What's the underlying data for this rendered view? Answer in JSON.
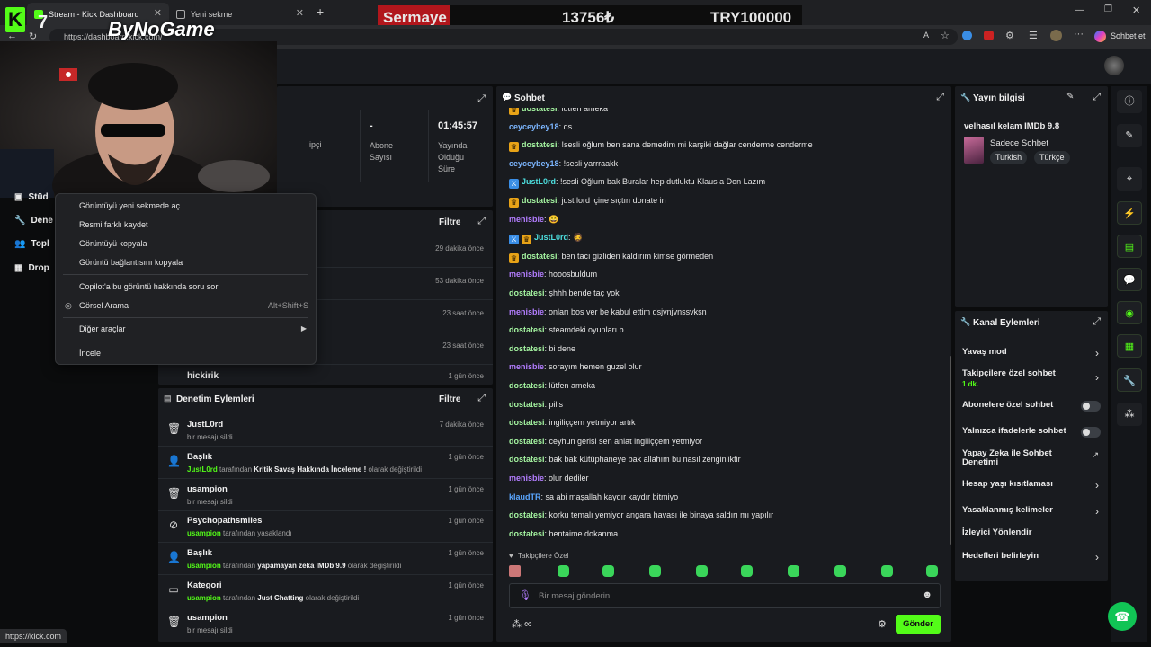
{
  "browser": {
    "tabs": [
      {
        "title": "Stream - Kick Dashboard",
        "active": true
      },
      {
        "title": "Yeni sekme",
        "active": false
      }
    ],
    "new_tab_icon": "plus-icon",
    "url": "https://dashboard.kick.com/",
    "chat_button": "Sohbet et"
  },
  "overlay": {
    "logo_mark": "K",
    "logo_number": "7",
    "brand": "ByNoGame",
    "ticker_label": "Sermaye",
    "ticker_value": "13756₺",
    "ticker_goal": "TRY100000"
  },
  "colors": {
    "accent": "#53fc18",
    "panel": "#191b1f",
    "bg": "#0b0c0d"
  },
  "left_nav": {
    "items": [
      {
        "label": "Stüd",
        "icon": "studio-icon"
      },
      {
        "label": "Dene",
        "icon": "wrench-icon"
      },
      {
        "label": "Topl",
        "icon": "users-icon"
      },
      {
        "label": "Drop",
        "icon": "drops-icon"
      }
    ]
  },
  "stats": {
    "fragment": "ipçi",
    "subscribers_value": "-",
    "subscribers_label": "Abone Sayısı",
    "uptime_value": "01:45:57",
    "uptime_label": "Yayında Olduğu Süre"
  },
  "followers_panel": {
    "filter": "Filtre",
    "times": [
      "29 dakika önce",
      "53 dakika önce",
      "23 saat önce",
      "23 saat önce"
    ],
    "last_name": "hickirik",
    "last_time": "1 gün önce"
  },
  "mod_actions": {
    "title": "Denetim Eylemleri",
    "filter": "Filtre",
    "items": [
      {
        "icon": "trash-icon",
        "title": "JustL0rd",
        "time": "7 dakika önce",
        "user": "",
        "middle": "bir mesajı sildi",
        "value": "",
        "tail": ""
      },
      {
        "icon": "user-edit-icon",
        "title": "Başlık",
        "time": "1 gün önce",
        "user": "JustL0rd",
        "middle": "tarafından",
        "value": "Kritik Savaş Hakkında İnceleme !",
        "tail": "olarak değiştirildi"
      },
      {
        "icon": "trash-icon",
        "title": "usampion",
        "time": "1 gün önce",
        "user": "",
        "middle": "bir mesajı sildi",
        "value": "",
        "tail": ""
      },
      {
        "icon": "ban-icon",
        "title": "Psychopathsmiles",
        "time": "1 gün önce",
        "user": "usampion",
        "middle": "tarafından yasaklandı",
        "value": "",
        "tail": ""
      },
      {
        "icon": "user-edit-icon",
        "title": "Başlık",
        "time": "1 gün önce",
        "user": "usampion",
        "middle": "tarafından",
        "value": "yapamayan zeka IMDb 9.9",
        "tail": "olarak değiştirildi"
      },
      {
        "icon": "category-icon",
        "title": "Kategori",
        "time": "1 gün önce",
        "user": "usampion",
        "middle": "tarafından",
        "value": "Just Chatting",
        "tail": "olarak değiştirildi"
      },
      {
        "icon": "trash-icon",
        "title": "usampion",
        "time": "1 gün önce",
        "user": "",
        "middle": "bir mesajı sildi",
        "value": "",
        "tail": ""
      }
    ]
  },
  "chat": {
    "title": "Sohbet",
    "messages": [
      {
        "badges": [
          "gold"
        ],
        "user": "dostatesi",
        "color": "green",
        "text": "lütfen ameka"
      },
      {
        "badges": [],
        "user": "ceyceybey18",
        "color": "lblue",
        "text": "ds"
      },
      {
        "badges": [
          "gold"
        ],
        "user": "dostatesi",
        "color": "green",
        "text": "!sesli oğlum ben sana demedim mi karşiki dağlar cenderme cenderme"
      },
      {
        "badges": [],
        "user": "ceyceybey18",
        "color": "lblue",
        "text": "!sesli yarrraakk"
      },
      {
        "badges": [
          "blue"
        ],
        "user": "JustL0rd",
        "color": "teal",
        "text": "!sesli Oğlum bak Buralar hep dutluktu Klaus a Don Lazım"
      },
      {
        "badges": [
          "gold"
        ],
        "user": "dostatesi",
        "color": "green",
        "text": "just lord içine sıçtın donate in"
      },
      {
        "badges": [],
        "user": "menisbie",
        "color": "purple",
        "text": "😄"
      },
      {
        "badges": [
          "blue",
          "gold"
        ],
        "user": "JustL0rd",
        "color": "teal",
        "text": "🧔"
      },
      {
        "badges": [
          "gold"
        ],
        "user": "dostatesi",
        "color": "green",
        "text": "ben tacı gizliden kaldırım kimse görmeden"
      },
      {
        "badges": [],
        "user": "menisbie",
        "color": "purple",
        "text": "hooosbuldum"
      },
      {
        "badges": [],
        "user": "dostatesi",
        "color": "green",
        "text": "şhhh bende taç yok"
      },
      {
        "badges": [],
        "user": "menisbie",
        "color": "purple",
        "text": "onları bos ver be kabul ettim dsjvnjvnssvksn"
      },
      {
        "badges": [],
        "user": "dostatesi",
        "color": "green",
        "text": "steamdeki oyunları b"
      },
      {
        "badges": [],
        "user": "dostatesi",
        "color": "green",
        "text": "bi dene"
      },
      {
        "badges": [],
        "user": "menisbie",
        "color": "purple",
        "text": "sorayım hemen guzel olur"
      },
      {
        "badges": [],
        "user": "dostatesi",
        "color": "green",
        "text": "lütfen ameka"
      },
      {
        "badges": [],
        "user": "dostatesi",
        "color": "green",
        "text": "pilis"
      },
      {
        "badges": [],
        "user": "dostatesi",
        "color": "green",
        "text": "ingiliççem yetmiyor artık"
      },
      {
        "badges": [],
        "user": "dostatesi",
        "color": "green",
        "text": "ceyhun gerisi sen anlat ingiliççem yetmiyor"
      },
      {
        "badges": [],
        "user": "dostatesi",
        "color": "green",
        "text": "bak bak kütüphaneye bak allahım bu nasıl zenginliktir"
      },
      {
        "badges": [],
        "user": "menisbie",
        "color": "purple",
        "text": "olur dediler"
      },
      {
        "badges": [],
        "user": "klaudTR",
        "color": "blue",
        "text": "sa abi maşallah kaydır kaydır bitmiyo"
      },
      {
        "badges": [],
        "user": "dostatesi",
        "color": "green",
        "text": "korku temalı yemiyor angara havası ile binaya saldırı mı yapılır"
      },
      {
        "badges": [],
        "user": "dostatesi",
        "color": "green",
        "text": "hentaime dokanma"
      }
    ],
    "followers_only": "Takipçilere Özel",
    "input_placeholder": "Bir mesaj gönderin",
    "send": "Gönder"
  },
  "stream_info": {
    "title": "Yayın bilgisi",
    "stream_title": "velhasıl kelam IMDb 9.8",
    "category": "Sadece Sohbet",
    "tags": [
      "Turkish",
      "Türkçe"
    ]
  },
  "channel_actions": {
    "title": "Kanal Eylemleri",
    "items": [
      {
        "label": "Yavaş mod",
        "sub": "",
        "kind": "arrow"
      },
      {
        "label": "Takipçilere özel sohbet",
        "sub": "1 dk.",
        "kind": "arrow"
      },
      {
        "label": "Abonelere özel sohbet",
        "sub": "",
        "kind": "toggle"
      },
      {
        "label": "Yalnızca ifadelerle sohbet",
        "sub": "",
        "kind": "toggle"
      },
      {
        "label": "Yapay Zeka ile Sohbet Denetimi",
        "sub": "",
        "kind": "external"
      },
      {
        "label": "Hesap yaşı kısıtlaması",
        "sub": "",
        "kind": "arrow"
      },
      {
        "label": "Yasaklanmış kelimeler",
        "sub": "",
        "kind": "arrow"
      },
      {
        "label": "İzleyici Yönlendir",
        "sub": "",
        "kind": "none"
      },
      {
        "label": "Hedefleri belirleyin",
        "sub": "",
        "kind": "arrow"
      }
    ]
  },
  "context_menu": {
    "items": [
      {
        "label": "Görüntüyü yeni sekmede aç",
        "shortcut": ""
      },
      {
        "label": "Resmi farklı kaydet",
        "shortcut": ""
      },
      {
        "label": "Görüntüyü kopyala",
        "shortcut": ""
      },
      {
        "label": "Görüntü bağlantısını kopyala",
        "shortcut": ""
      },
      {
        "label": "Copilot'a bu görüntü hakkında soru sor",
        "shortcut": ""
      },
      {
        "label": "Görsel Arama",
        "shortcut": "Alt+Shift+S"
      },
      {
        "label": "Diğer araçlar",
        "shortcut": ""
      },
      {
        "label": "İncele",
        "shortcut": ""
      }
    ]
  },
  "status_bar": "https://kick.com"
}
